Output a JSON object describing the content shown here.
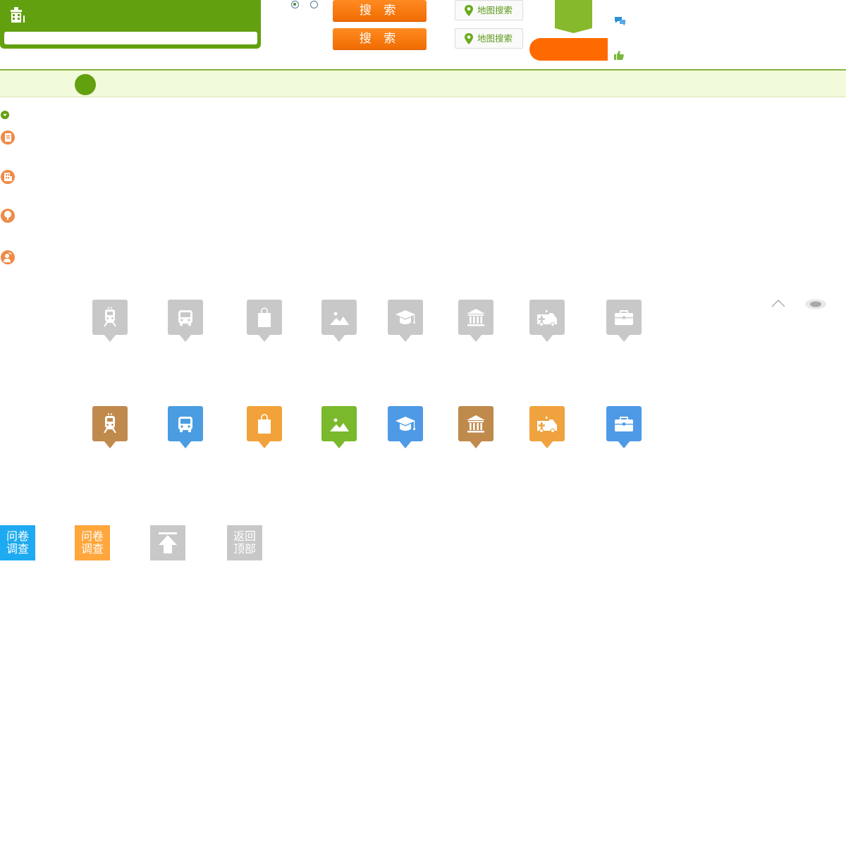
{
  "header": {
    "radio_options": [
      "",
      ""
    ],
    "search_buttons": [
      {
        "label": "搜 索"
      },
      {
        "label": "搜 索"
      }
    ],
    "map_search_buttons": [
      {
        "label": "地图搜索"
      },
      {
        "label": "地图搜索"
      }
    ]
  },
  "poi_icons": {
    "names": [
      "train-icon",
      "bus-icon",
      "shopping-bag-icon",
      "landscape-icon",
      "graduation-cap-icon",
      "bank-icon",
      "ambulance-icon",
      "briefcase-icon"
    ],
    "inactive_color": "#c8c8c8",
    "active_colors": [
      "#c08a4d",
      "#4a9de0",
      "#f2a23a",
      "#7ab82c",
      "#4e9ae6",
      "#bf8a4c",
      "#f0a23e",
      "#4e9ae6"
    ]
  },
  "widgets": {
    "survey_blue": {
      "line1": "问卷",
      "line2": "调查",
      "color": "#1eaaf1"
    },
    "survey_orange": {
      "line1": "问卷",
      "line2": "调查",
      "color": "#ffa63d"
    },
    "back_top_arrow": {
      "color": "#c8c8c8"
    },
    "back_top_text": {
      "line1": "返回",
      "line2": "顶部",
      "color": "#c8c8c8"
    }
  },
  "colors": {
    "brand_green": "#63a00f",
    "brand_orange": "#ff6a00",
    "side_icon_orange": "#ef8a47"
  }
}
